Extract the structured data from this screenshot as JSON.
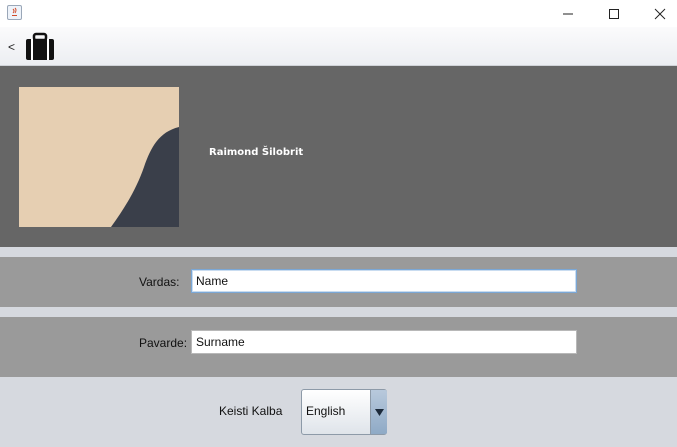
{
  "window": {
    "title": "",
    "controls": [
      "minimize",
      "maximize",
      "close"
    ]
  },
  "toolbar": {
    "back_label": "<",
    "icon": "suitcase-icon"
  },
  "profile": {
    "name": "Raimond Šilobrit"
  },
  "form": {
    "first_name_label": "Vardas:",
    "first_name_value": "Name",
    "last_name_label": "Pavarde:",
    "last_name_value": "Surname"
  },
  "language": {
    "label": "Keisti Kalba",
    "selected": "English"
  },
  "colors": {
    "profile_bg": "#666666",
    "row_bg": "#9a9a9a",
    "page_bg": "#d6d9df"
  }
}
